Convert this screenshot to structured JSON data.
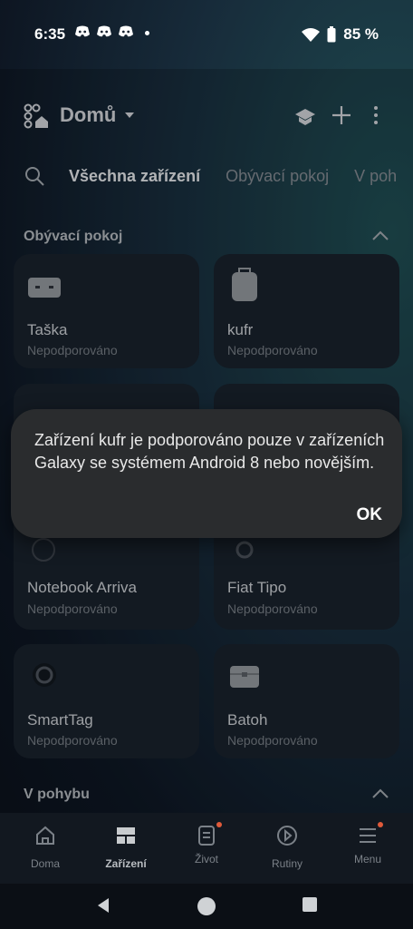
{
  "status_bar": {
    "time": "6:35",
    "battery": "85 %"
  },
  "header": {
    "title": "Domů"
  },
  "tabs": [
    "Všechna zařízení",
    "Obývací pokoj",
    "V poh"
  ],
  "sections": [
    {
      "title": "Obývací pokoj"
    },
    {
      "title": "V pohybu"
    }
  ],
  "devices": [
    {
      "name": "Taška",
      "status": "Nepodporováno",
      "icon": "bag-icon"
    },
    {
      "name": "kufr",
      "status": "Nepodporováno",
      "icon": "suitcase-icon"
    },
    {
      "name": "Notebook Arriva",
      "status": "Nepodporováno",
      "icon": "tracker-icon"
    },
    {
      "name": "Fiat Tipo",
      "status": "Nepodporováno",
      "icon": "tracker-icon"
    },
    {
      "name": "SmartTag",
      "status": "Nepodporováno",
      "icon": "tracker-icon"
    },
    {
      "name": "Batoh",
      "status": "Nepodporováno",
      "icon": "backpack-icon"
    }
  ],
  "dialog": {
    "message": "Zařízení kufr je podporováno pouze v zařízeních Galaxy se systémem Android 8 nebo novějším.",
    "ok_label": "OK"
  },
  "bottom_nav": [
    {
      "label": "Doma",
      "icon": "home-icon"
    },
    {
      "label": "Zařízení",
      "icon": "devices-icon",
      "active": true
    },
    {
      "label": "Život",
      "icon": "life-icon",
      "badge": true
    },
    {
      "label": "Rutiny",
      "icon": "routines-icon"
    },
    {
      "label": "Menu",
      "icon": "menu-icon",
      "badge": true
    }
  ]
}
